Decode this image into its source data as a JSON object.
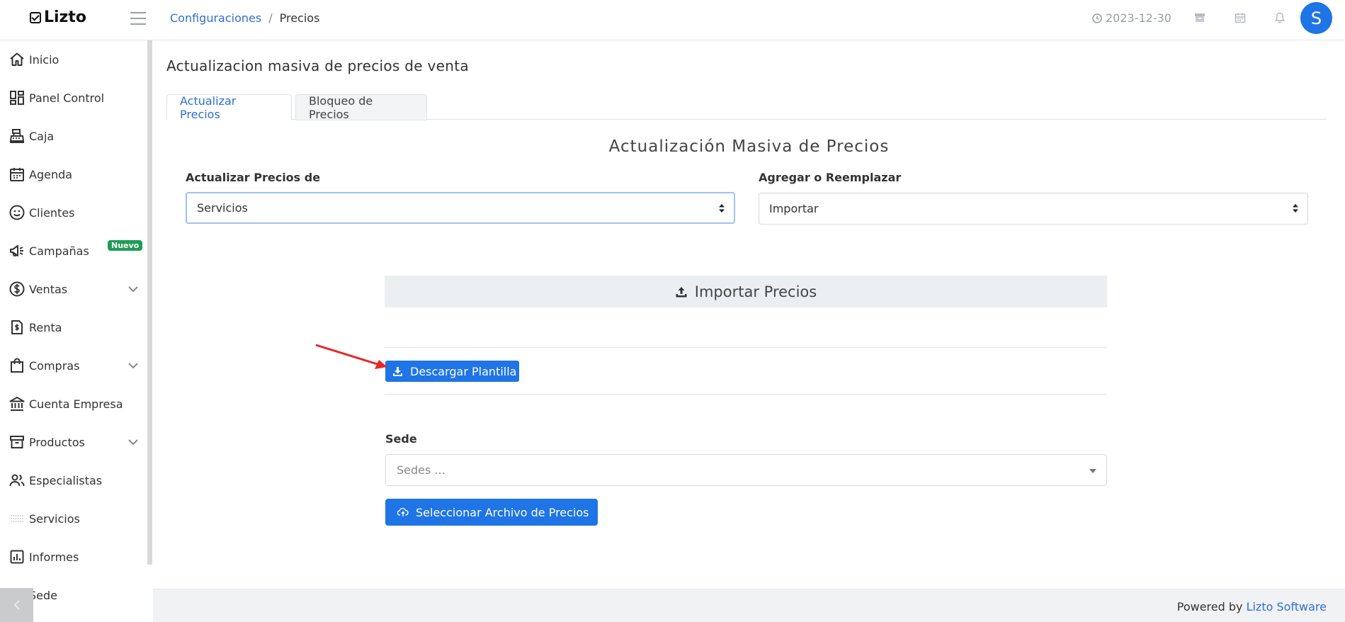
{
  "app": {
    "name": "Lizto"
  },
  "breadcrumb": {
    "parent": "Configuraciones",
    "separator": "/",
    "current": "Precios"
  },
  "header": {
    "date": "2023-12-30",
    "avatar_letter": "S"
  },
  "sidebar": {
    "items": [
      {
        "label": "Inicio",
        "icon": "home-icon"
      },
      {
        "label": "Panel Control",
        "icon": "dashboard-icon"
      },
      {
        "label": "Caja",
        "icon": "cash-register-icon"
      },
      {
        "label": "Agenda",
        "icon": "calendar-icon"
      },
      {
        "label": "Clientes",
        "icon": "smiley-icon"
      },
      {
        "label": "Campañas",
        "icon": "megaphone-icon",
        "badge": "Nuevo"
      },
      {
        "label": "Ventas",
        "icon": "dollar-circle-icon",
        "expandable": true
      },
      {
        "label": "Renta",
        "icon": "receipt-icon"
      },
      {
        "label": "Compras",
        "icon": "shopping-bag-icon",
        "expandable": true
      },
      {
        "label": "Cuenta Empresa",
        "icon": "bank-icon"
      },
      {
        "label": "Productos",
        "icon": "archive-box-icon",
        "expandable": true
      },
      {
        "label": "Especialistas",
        "icon": "users-icon"
      },
      {
        "label": "Servicios",
        "icon": "list-icon"
      },
      {
        "label": "Informes",
        "icon": "bar-chart-icon"
      },
      {
        "label": "Sede",
        "icon": "building-icon"
      }
    ]
  },
  "main": {
    "title": "Actualizacion masiva de precios de venta",
    "tabs": [
      {
        "label": "Actualizar Precios",
        "active": true
      },
      {
        "label": "Bloqueo de Precios",
        "active": false
      }
    ],
    "section_title": "Actualización Masiva de Precios",
    "update_field": {
      "label": "Actualizar Precios de",
      "value": "Servicios"
    },
    "mode_field": {
      "label": "Agregar o Reemplazar",
      "value": "Importar"
    },
    "import_header": "Importar Precios",
    "download_button": "Descargar Plantilla",
    "sede_field": {
      "label": "Sede",
      "placeholder": "Sedes ..."
    },
    "select_file_button": "Seleccionar Archivo de Precios"
  },
  "footer": {
    "prefix": "Powered by",
    "brand": "Lizto Software"
  },
  "colors": {
    "primary": "#1f74e6",
    "link": "#2f6fd1",
    "badge": "#1f9d55",
    "annotation_arrow": "#e8262a"
  }
}
